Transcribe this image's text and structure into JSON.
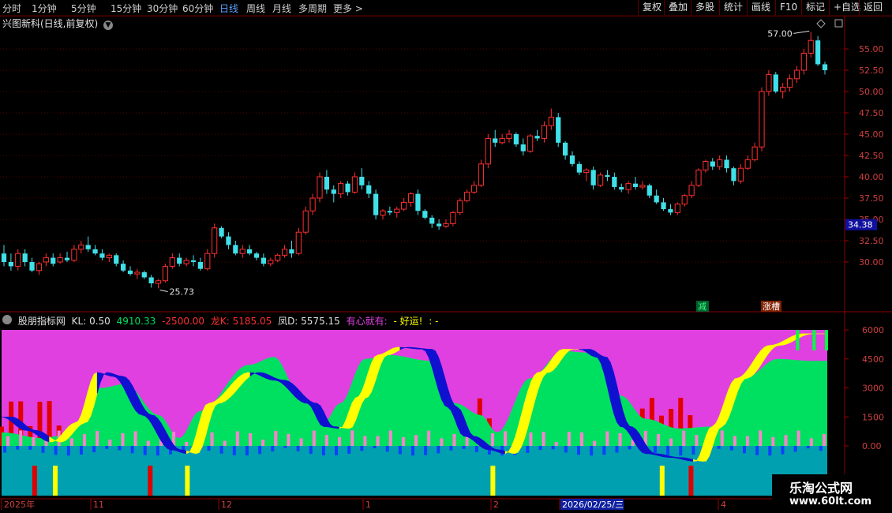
{
  "toolbar": {
    "periods": [
      "分时",
      "1分钟",
      "5分钟",
      "15分钟",
      "30分钟",
      "60分钟",
      "日线",
      "周线",
      "月线",
      "多周期",
      "更多 >"
    ],
    "active_period": "日线",
    "right_buttons": [
      "复权",
      "叠加",
      "多股",
      "统计",
      "画线",
      "F10",
      "标记",
      "+自选",
      "返回"
    ]
  },
  "main_chart": {
    "title": "兴图新科(日线,前复权)",
    "y_ticks": [
      "55.00",
      "52.50",
      "50.00",
      "47.50",
      "45.00",
      "42.50",
      "40.00",
      "37.50",
      "35.00",
      "32.50",
      "30.00"
    ],
    "current_price": "34.38",
    "high_label": "57.00",
    "low_label": "25.73",
    "signal_labels": [
      "减",
      "涨槽"
    ]
  },
  "indicator": {
    "name": "股朋指标网",
    "kl_label": "KL: 0.50",
    "v1": "4910.33",
    "v2": "-2500.00",
    "long_label": "龙K: 5185.05",
    "feng_label": "凤D: 5575.15",
    "msg1": "有心就有:",
    "msg2": "- 好运!",
    "msg3": ": -",
    "y_ticks": [
      "6000",
      "4500",
      "3000",
      "1500",
      "0.00"
    ]
  },
  "x_axis": {
    "labels": [
      "2025年",
      "11",
      "12",
      "1",
      "2",
      "2026/02/25/三",
      "4"
    ]
  },
  "watermark": {
    "line1": "乐淘公式网",
    "line2": "www.60lt.com"
  },
  "colors": {
    "up": "#ff3030",
    "down": "#40e0e8",
    "magenta": "#e040e0",
    "green": "#00e060",
    "yellow": "#ffff00",
    "blue": "#1010d0",
    "teal": "#00a0b0"
  },
  "chart_data": {
    "type": "candlestick",
    "ylim": [
      27.5,
      57.5
    ],
    "candles": [
      [
        31,
        32,
        29.5,
        30
      ],
      [
        30,
        31,
        29,
        29.5
      ],
      [
        29.5,
        31.5,
        29,
        31
      ],
      [
        31,
        31.5,
        29.5,
        30
      ],
      [
        30,
        30.5,
        28.8,
        29
      ],
      [
        29,
        30,
        28.5,
        29.8
      ],
      [
        30,
        31,
        29.5,
        30.5
      ],
      [
        30.5,
        31,
        29.5,
        29.8
      ],
      [
        30,
        31,
        29.8,
        30.5
      ],
      [
        30.5,
        31.2,
        30,
        30.2
      ],
      [
        30.2,
        32,
        30,
        31.5
      ],
      [
        31.5,
        32.5,
        31,
        32
      ],
      [
        32,
        33,
        31.2,
        31.5
      ],
      [
        31.5,
        32,
        30.8,
        31
      ],
      [
        31,
        31.5,
        30.2,
        30.5
      ],
      [
        30.5,
        31,
        30,
        30.8
      ],
      [
        30.8,
        31,
        29.5,
        29.8
      ],
      [
        29.8,
        30.2,
        28.8,
        29
      ],
      [
        29,
        29.5,
        28.4,
        28.6
      ],
      [
        28.6,
        29.2,
        28,
        28.8
      ],
      [
        28.8,
        29,
        28,
        28.2
      ],
      [
        28.2,
        28.5,
        27,
        27.5
      ],
      [
        27.5,
        28,
        26.9,
        27.8
      ],
      [
        27.8,
        29.8,
        27.6,
        29.5
      ],
      [
        29.5,
        31,
        29.2,
        30.5
      ],
      [
        30.5,
        31,
        29.5,
        29.8
      ],
      [
        29.8,
        30.5,
        29.5,
        30.2
      ],
      [
        30.2,
        30.8,
        29.5,
        30
      ],
      [
        30,
        30.5,
        29,
        29.2
      ],
      [
        29.2,
        31.5,
        29,
        31
      ],
      [
        31,
        34.5,
        30.5,
        34
      ],
      [
        34,
        34.2,
        32.8,
        33
      ],
      [
        33,
        33.5,
        31.5,
        32
      ],
      [
        32,
        32.5,
        30.8,
        31
      ],
      [
        31,
        32,
        30.5,
        31.5
      ],
      [
        31.5,
        32,
        30.8,
        31
      ],
      [
        31,
        31.2,
        30.2,
        30.5
      ],
      [
        30.5,
        31,
        29.5,
        29.8
      ],
      [
        29.8,
        30.5,
        29.5,
        30.2
      ],
      [
        30.2,
        31,
        30,
        30.8
      ],
      [
        30.8,
        32,
        30.5,
        31.5
      ],
      [
        31.5,
        32.5,
        30.5,
        31
      ],
      [
        31,
        34,
        30.8,
        33.5
      ],
      [
        33.5,
        36.5,
        33.2,
        36
      ],
      [
        36,
        38,
        35.5,
        37.5
      ],
      [
        37.5,
        40.5,
        37,
        40
      ],
      [
        40,
        40.8,
        38,
        38.5
      ],
      [
        38.5,
        39,
        37,
        38
      ],
      [
        38,
        39.5,
        37.5,
        39.2
      ],
      [
        39.2,
        39.5,
        37.8,
        38.2
      ],
      [
        38.2,
        40.5,
        38,
        40
      ],
      [
        40,
        41,
        38.5,
        39
      ],
      [
        39,
        39.5,
        37.5,
        38
      ],
      [
        38,
        38.5,
        35,
        35.5
      ],
      [
        35.5,
        36.2,
        35,
        36
      ],
      [
        36,
        36.5,
        35.5,
        35.8
      ],
      [
        35.8,
        36.5,
        35.2,
        36.2
      ],
      [
        36.2,
        37.5,
        36,
        37
      ],
      [
        37,
        38.2,
        36.5,
        38
      ],
      [
        38,
        38.5,
        35.5,
        36
      ],
      [
        36,
        36.2,
        35,
        35.2
      ],
      [
        35.2,
        35.5,
        34,
        34.5
      ],
      [
        34.5,
        35,
        33.8,
        34.2
      ],
      [
        34.2,
        35,
        34,
        34.5
      ],
      [
        34.5,
        36,
        34.2,
        35.8
      ],
      [
        35.8,
        37.5,
        35.5,
        37.2
      ],
      [
        37.2,
        38.5,
        37,
        38.2
      ],
      [
        38.2,
        39.5,
        38,
        39
      ],
      [
        39,
        42,
        38.8,
        41.5
      ],
      [
        41.5,
        45,
        41,
        44.5
      ],
      [
        44.5,
        45.5,
        43.5,
        44
      ],
      [
        44,
        45,
        43.8,
        44.5
      ],
      [
        44.5,
        45.5,
        44,
        45
      ],
      [
        45,
        45.2,
        43.5,
        43.8
      ],
      [
        43.8,
        44.5,
        42.5,
        43
      ],
      [
        43,
        45,
        42.8,
        44.8
      ],
      [
        44.8,
        45.5,
        44.2,
        44.5
      ],
      [
        44.5,
        46.5,
        44,
        46
      ],
      [
        46,
        48,
        45.5,
        47
      ],
      [
        47,
        47.5,
        43.5,
        44
      ],
      [
        44,
        44.2,
        42,
        42.5
      ],
      [
        42.5,
        43,
        41.2,
        41.5
      ],
      [
        41.5,
        41.8,
        40.2,
        40.5
      ],
      [
        40.5,
        41,
        39.5,
        40.8
      ],
      [
        40.8,
        41.2,
        38.5,
        39
      ],
      [
        39,
        40.5,
        38.8,
        40.2
      ],
      [
        40.2,
        40.8,
        39.5,
        40
      ],
      [
        40,
        40.5,
        38.5,
        38.8
      ],
      [
        38.8,
        39.2,
        38.2,
        38.5
      ],
      [
        38.5,
        39.5,
        38,
        39.2
      ],
      [
        39.2,
        40,
        38.5,
        38.8
      ],
      [
        38.8,
        39.5,
        38.5,
        39
      ],
      [
        39,
        39.2,
        37.5,
        37.8
      ],
      [
        37.8,
        38.5,
        36.8,
        37
      ],
      [
        37,
        37.5,
        36,
        36.2
      ],
      [
        36.2,
        36.8,
        35.5,
        35.8
      ],
      [
        35.8,
        37,
        35.5,
        36.8
      ],
      [
        36.8,
        38,
        36.5,
        37.8
      ],
      [
        37.8,
        39.5,
        37.5,
        39
      ],
      [
        39,
        41,
        38.8,
        40.8
      ],
      [
        40.8,
        42,
        40.5,
        41.8
      ],
      [
        41.8,
        42.2,
        40.8,
        41.2
      ],
      [
        41.2,
        42.5,
        40.8,
        42
      ],
      [
        42,
        42.5,
        40.5,
        41
      ],
      [
        41,
        41.2,
        39,
        39.5
      ],
      [
        39.5,
        41.5,
        39.2,
        41
      ],
      [
        41,
        42.5,
        40.8,
        42
      ],
      [
        42,
        44,
        41.8,
        43.5
      ],
      [
        43.5,
        50.5,
        43,
        50
      ],
      [
        50,
        52.5,
        49.5,
        52
      ],
      [
        52,
        52.3,
        49.8,
        50
      ],
      [
        50,
        51,
        49.2,
        50.5
      ],
      [
        50.5,
        52,
        50,
        51.5
      ],
      [
        51.5,
        53,
        51,
        52.5
      ],
      [
        52.5,
        55,
        52,
        54.5
      ],
      [
        54.5,
        57,
        54,
        56
      ],
      [
        56,
        56.5,
        53,
        53.2
      ],
      [
        53.2,
        53.5,
        52,
        52.5
      ]
    ],
    "up_color": "#ff3030",
    "down_color": "#40e0e8"
  }
}
